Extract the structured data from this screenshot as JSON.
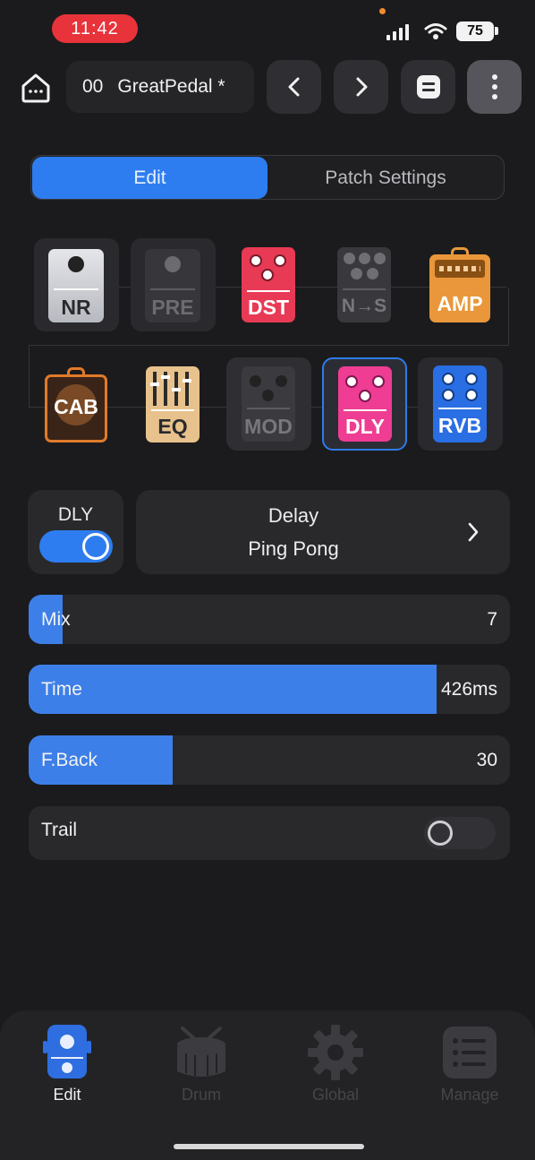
{
  "status_bar": {
    "time": "11:42",
    "battery": "75"
  },
  "header": {
    "patch_number": "00",
    "patch_name": "GreatPedal *"
  },
  "tabs": {
    "edit_label": "Edit",
    "patch_settings_label": "Patch Settings"
  },
  "effect_chain": [
    {
      "id": "NR",
      "label": "NR",
      "active": true
    },
    {
      "id": "PRE",
      "label": "PRE",
      "active": false
    },
    {
      "id": "DST",
      "label": "DST",
      "active": true
    },
    {
      "id": "NS",
      "label": "N→S",
      "active": false
    },
    {
      "id": "AMP",
      "label": "AMP",
      "active": true
    },
    {
      "id": "CAB",
      "label": "CAB",
      "active": true
    },
    {
      "id": "EQ",
      "label": "EQ",
      "active": true
    },
    {
      "id": "MOD",
      "label": "MOD",
      "active": false
    },
    {
      "id": "DLY",
      "label": "DLY",
      "active": true,
      "selected": true
    },
    {
      "id": "RVB",
      "label": "RVB",
      "active": true
    }
  ],
  "block": {
    "name": "DLY",
    "enabled": true,
    "type": "Delay",
    "model": "Ping Pong"
  },
  "params": {
    "mix": {
      "label": "Mix",
      "value": "7",
      "fraction": 0.07
    },
    "time": {
      "label": "Time",
      "value": "426ms",
      "fraction": 0.848
    },
    "feedback": {
      "label": "F.Back",
      "value": "30",
      "fraction": 0.3
    },
    "trail": {
      "label": "Trail",
      "enabled": false
    }
  },
  "bottom_tabs": {
    "edit": "Edit",
    "drum": "Drum",
    "global": "Global",
    "manage": "Manage"
  },
  "colors": {
    "accent": "#2e7df0",
    "background": "#1b1b1d",
    "card": "#29292c"
  }
}
